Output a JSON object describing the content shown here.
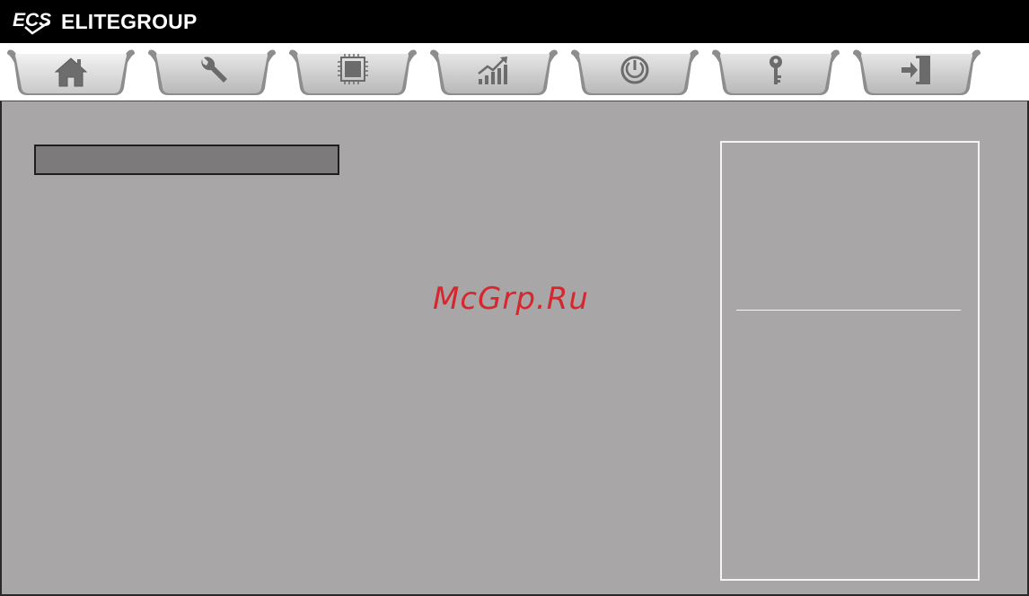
{
  "header": {
    "brand_logo_text": "ECS",
    "brand_name": "ELITEGROUP",
    "background": "#000000"
  },
  "tabs": [
    {
      "name": "home",
      "icon": "home-icon",
      "selected": true
    },
    {
      "name": "tools",
      "icon": "wrench-icon",
      "selected": false
    },
    {
      "name": "processor",
      "icon": "chip-icon",
      "selected": false
    },
    {
      "name": "performance",
      "icon": "chart-up-icon",
      "selected": false
    },
    {
      "name": "power",
      "icon": "power-icon",
      "selected": false
    },
    {
      "name": "security",
      "icon": "key-icon",
      "selected": false
    },
    {
      "name": "exit",
      "icon": "exit-icon",
      "selected": false
    }
  ],
  "main": {
    "background": "#a8a6a7",
    "selection_bar_color": "#7d7a7b",
    "help_panel_border": "#f4f4f4"
  },
  "watermark": {
    "text": "McGrp.Ru",
    "color": "#d6262e"
  }
}
